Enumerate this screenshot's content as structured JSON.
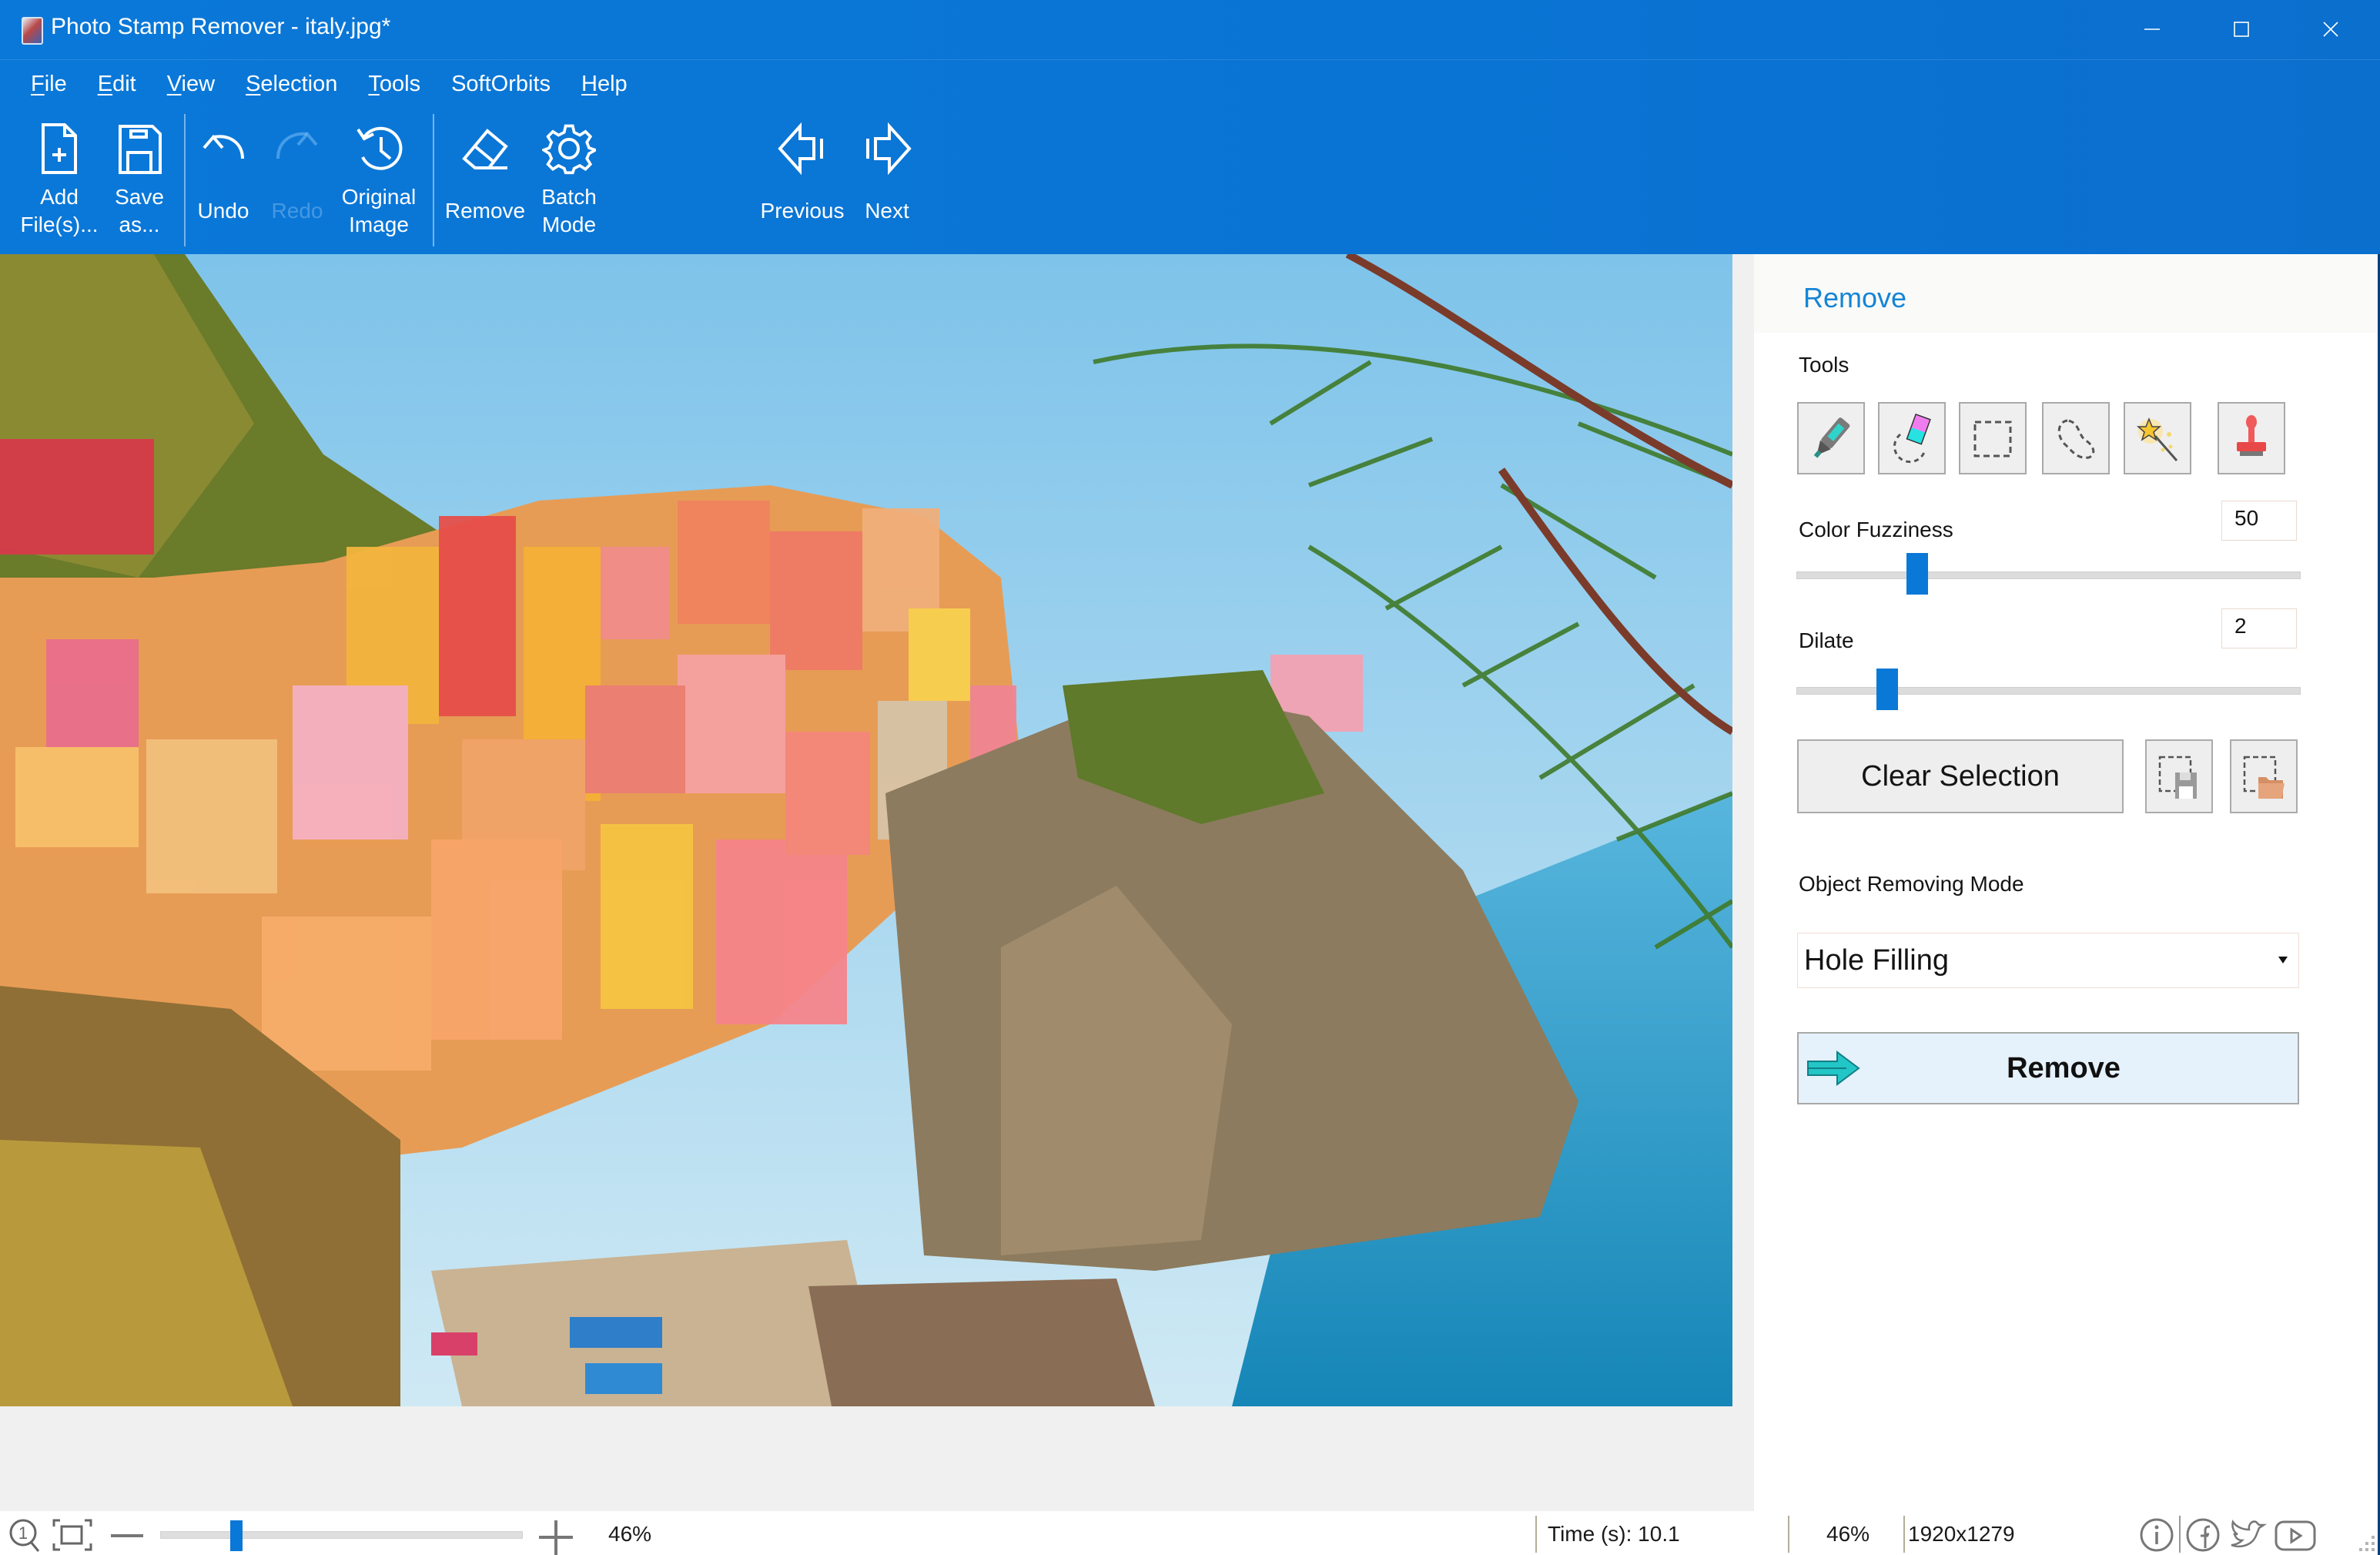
{
  "window": {
    "title": "Photo Stamp Remover - italy.jpg*",
    "controls": {
      "minimize": "minimize-icon",
      "maximize": "maximize-icon",
      "close": "close-icon"
    }
  },
  "menu": [
    {
      "label": "File",
      "mnemonic": "F"
    },
    {
      "label": "Edit",
      "mnemonic": "E"
    },
    {
      "label": "View",
      "mnemonic": "V"
    },
    {
      "label": "Selection",
      "mnemonic": "S"
    },
    {
      "label": "Tools",
      "mnemonic": "T"
    },
    {
      "label": "SoftOrbits",
      "mnemonic": ""
    },
    {
      "label": "Help",
      "mnemonic": "H"
    }
  ],
  "toolbar": {
    "add_files": {
      "label": "Add\nFile(s)...",
      "icon": "add-file-icon"
    },
    "save_as": {
      "label": "Save\nas...",
      "icon": "save-icon"
    },
    "undo": {
      "label": "Undo",
      "icon": "undo-icon",
      "enabled": true
    },
    "redo": {
      "label": "Redo",
      "icon": "redo-icon",
      "enabled": false
    },
    "original_image": {
      "label": "Original\nImage",
      "icon": "history-icon"
    },
    "remove": {
      "label": "Remove",
      "icon": "eraser-icon"
    },
    "batch_mode": {
      "label": "Batch\nMode",
      "icon": "gear-icon"
    },
    "previous": {
      "label": "Previous",
      "icon": "arrow-left-icon"
    },
    "next": {
      "label": "Next",
      "icon": "arrow-right-icon"
    }
  },
  "canvas": {
    "image_description": "Colorful cliffside village (Manarola, Cinque Terre) above the sea with pine branches"
  },
  "panel": {
    "title": "Remove",
    "tools_label": "Tools",
    "tools": [
      {
        "name": "marker",
        "icon": "marker-icon"
      },
      {
        "name": "eraser",
        "icon": "selection-eraser-icon"
      },
      {
        "name": "rectangle-select",
        "icon": "rectangle-select-icon"
      },
      {
        "name": "lasso-select",
        "icon": "lasso-icon"
      },
      {
        "name": "magic-wand",
        "icon": "magic-wand-icon"
      },
      {
        "name": "stamp",
        "icon": "stamp-icon"
      }
    ],
    "color_fuzziness": {
      "label": "Color Fuzziness",
      "value": "50",
      "slider_fraction": 0.24
    },
    "dilate": {
      "label": "Dilate",
      "value": "2",
      "slider_fraction": 0.18
    },
    "clear_selection": "Clear Selection",
    "save_selection_icon": "save-selection-icon",
    "load_selection_icon": "load-selection-icon",
    "mode_label": "Object Removing Mode",
    "mode_selected": "Hole Filling",
    "remove_button": "Remove"
  },
  "statusbar": {
    "zoom_percent": "46%",
    "zoom_slider_fraction": 0.21,
    "time": "Time (s): 10.1",
    "zoom_readout": "46%",
    "dimensions": "1920x1279",
    "icons": [
      "info-icon",
      "facebook-icon",
      "twitter-icon",
      "youtube-icon"
    ]
  },
  "colors": {
    "header_bg": "#0a78d8",
    "accent": "#1485d6",
    "slider_thumb": "#0a78d7",
    "remove_button_bg": "#e5f1fb",
    "canvas_bg": "#f0f0f0"
  }
}
